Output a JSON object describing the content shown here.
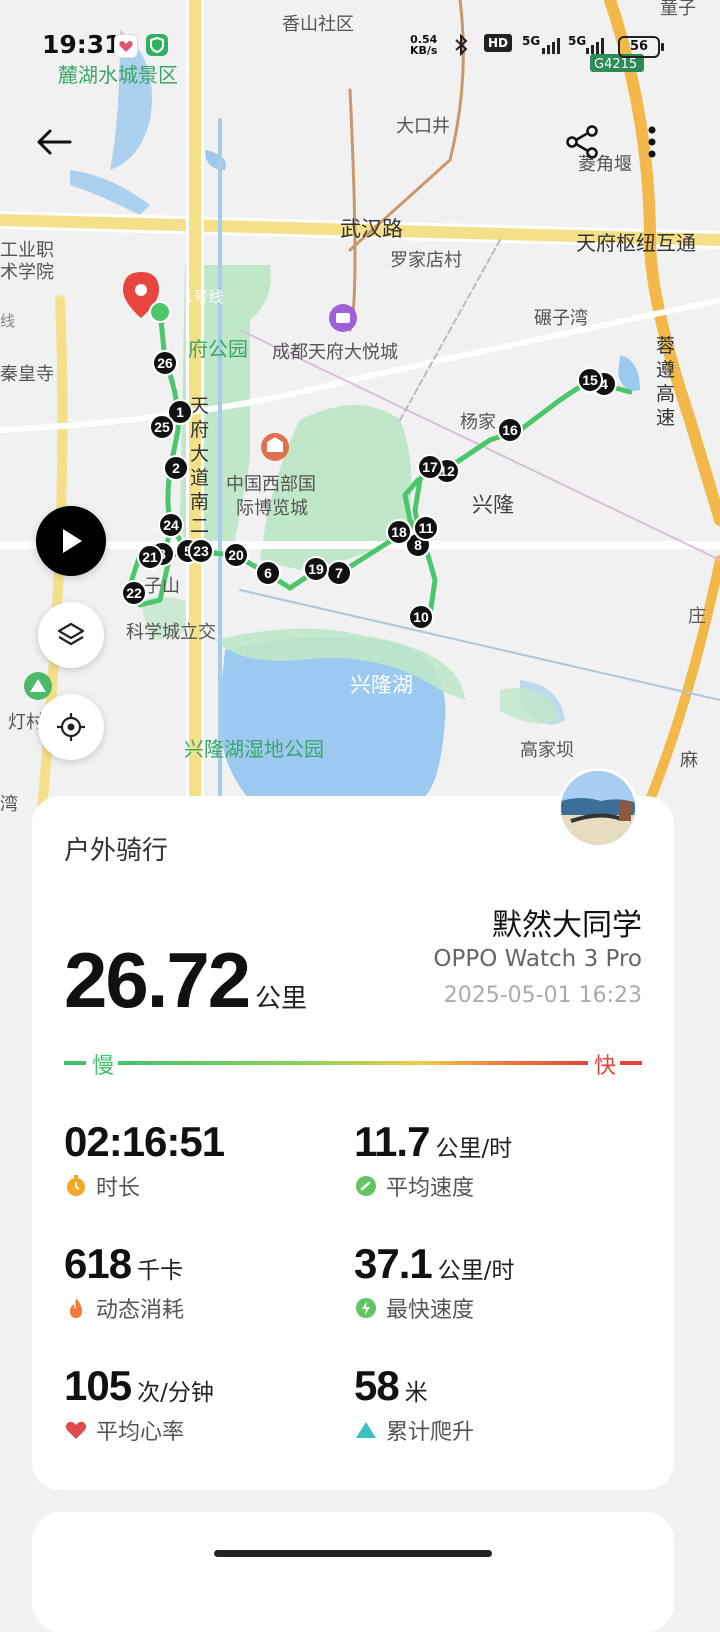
{
  "status_bar": {
    "time": "19:31",
    "net_speed_value": "0.54",
    "net_speed_unit": "KB/s",
    "hd_label": "HD",
    "sig1": "5G",
    "sig2": "5G",
    "battery": "56"
  },
  "map": {
    "labels": {
      "xiangshan": "香山社区",
      "scenic": "麓湖水城景区",
      "dakoujing": "大口井",
      "lingjiaoyan": "菱角堰",
      "wuhan_road": "武汉路",
      "interchange": "天府枢纽互通",
      "luojia": "罗家店村",
      "college1": "工业职",
      "college2": "术学院",
      "line1": "1号线",
      "line_left": "线",
      "fugongyuan": "府公园",
      "mall": "成都天府大悦城",
      "qinhuang": "秦皇寺",
      "nianzi": "碾子湾",
      "road_south": "天府大道南二",
      "expo1": "中国西部国",
      "expo2": "际博览城",
      "yangjia": "杨家",
      "xinglong": "兴隆",
      "rongzun": "蓉遵高速",
      "zishan": "子山",
      "kexuecheng": "科学城立交",
      "lake": "兴隆湖",
      "wetland": "兴隆湖湿地公园",
      "gaojiaba": "高家坝",
      "dengcun": "灯村",
      "wan": "湾",
      "zhuang": "庄",
      "ma": "麻",
      "tongzi": "童子",
      "highway_code": "G4215"
    },
    "markers": [
      "1",
      "2",
      "3",
      "4",
      "5",
      "6",
      "7",
      "8",
      "10",
      "11",
      "12",
      "15",
      "16",
      "17",
      "18",
      "19",
      "20",
      "21",
      "22",
      "23",
      "24",
      "25",
      "26"
    ]
  },
  "activity": {
    "type": "户外骑行",
    "distance": "26.72",
    "distance_unit": "公里",
    "user": "默然大同学",
    "device": "OPPO Watch 3 Pro",
    "datetime": "2025-05-01 16:23",
    "legend_slow": "慢",
    "legend_fast": "快"
  },
  "stats": {
    "duration": {
      "value": "02:16:51",
      "unit": "",
      "label": "时长"
    },
    "avg_speed": {
      "value": "11.7",
      "unit": "公里/时",
      "label": "平均速度"
    },
    "calories": {
      "value": "618",
      "unit": "千卡",
      "label": "动态消耗"
    },
    "max_speed": {
      "value": "37.1",
      "unit": "公里/时",
      "label": "最快速度"
    },
    "heart_rate": {
      "value": "105",
      "unit": "次/分钟",
      "label": "平均心率"
    },
    "climb": {
      "value": "58",
      "unit": "米",
      "label": "累计爬升"
    }
  },
  "colors": {
    "route": "#4cc66a",
    "slow": "#44c26a",
    "fast": "#e5433a",
    "pin": "#e8453c",
    "lake": "#9bc9ef",
    "park": "#bfe7c8"
  }
}
